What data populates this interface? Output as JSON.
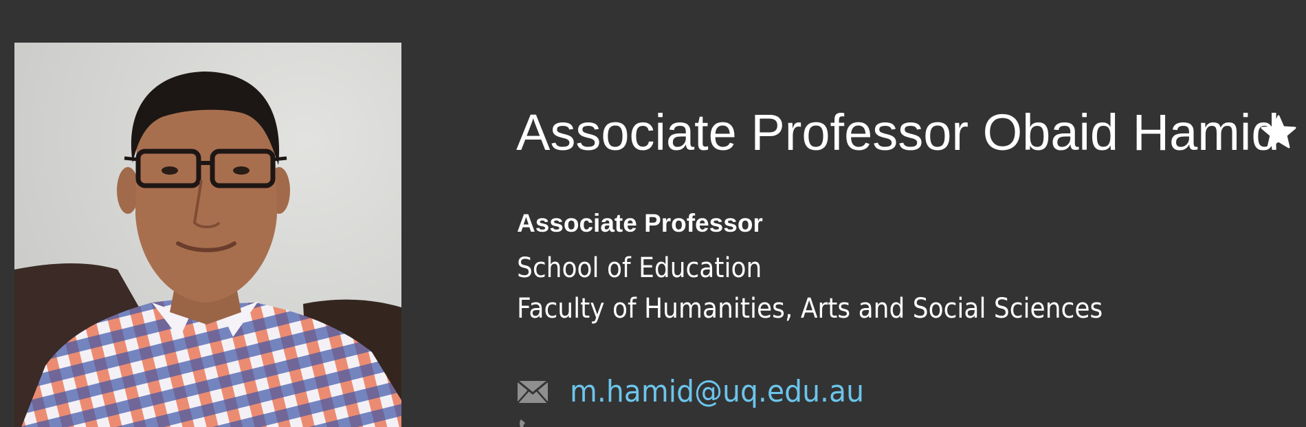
{
  "profile": {
    "name": "Associate Professor Obaid Hamid",
    "position": "Associate Professor",
    "school": "School of Education",
    "faculty": "Faculty of Humanities, Arts and Social Sciences",
    "photo_alt": "Portrait of Associate Professor Obaid Hamid"
  },
  "contact": {
    "email": "m.hamid@uq.edu.au",
    "email_icon": "mail-icon",
    "phone_icon": "phone-icon"
  },
  "actions": {
    "favourite_icon": "star-icon"
  },
  "colors": {
    "background": "#333333",
    "text": "#ffffff",
    "link": "#6cc5ec"
  }
}
